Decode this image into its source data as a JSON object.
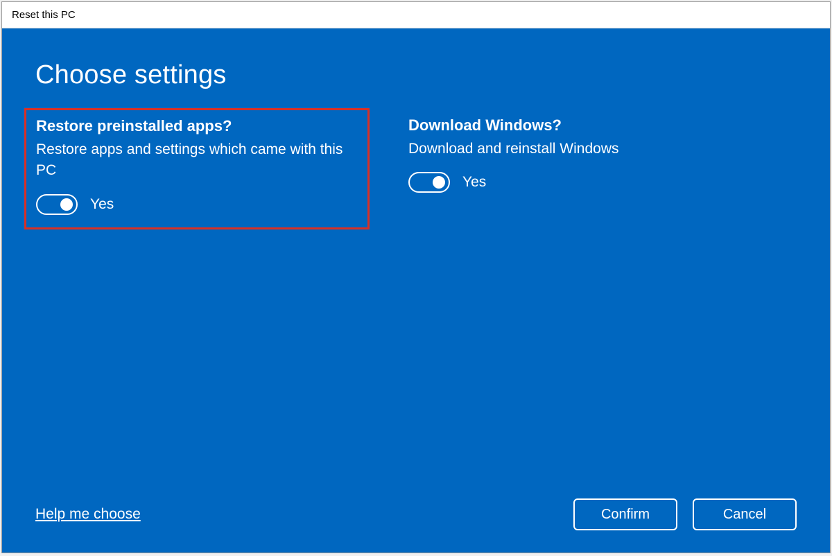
{
  "window": {
    "title": "Reset this PC"
  },
  "page": {
    "heading": "Choose settings"
  },
  "settings": {
    "restore": {
      "title": "Restore preinstalled apps?",
      "description": "Restore apps and settings which came with this PC",
      "value_label": "Yes",
      "highlighted": true
    },
    "download": {
      "title": "Download Windows?",
      "description": "Download and reinstall Windows",
      "value_label": "Yes",
      "highlighted": false
    }
  },
  "footer": {
    "help_link": "Help me choose",
    "confirm_label": "Confirm",
    "cancel_label": "Cancel"
  }
}
